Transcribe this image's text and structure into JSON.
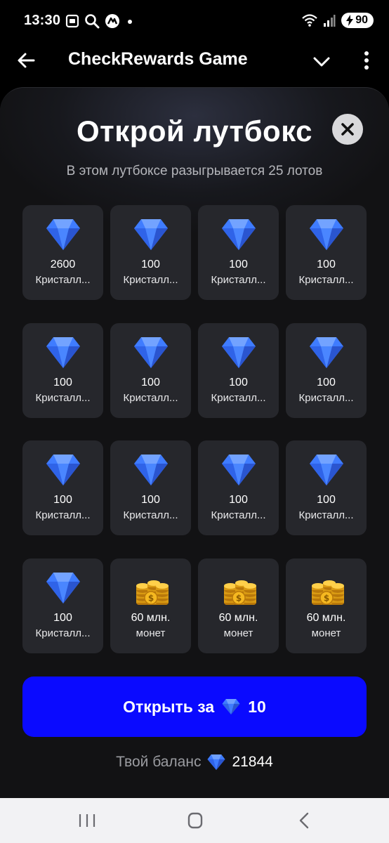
{
  "status": {
    "time": "13:30",
    "battery": "90",
    "left_icons": [
      "screenshot-icon",
      "search-icon",
      "app-badge-icon",
      "dot-icon"
    ],
    "right_icons": [
      "wifi-icon",
      "signal-icon",
      "battery-icon"
    ]
  },
  "appbar": {
    "title": "CheckRewards Game"
  },
  "sheet": {
    "title": "Открой лутбокс",
    "subtitle": "В этом лутбоксе разыгрывается 25 лотов",
    "items": [
      {
        "value": "2600",
        "name": "Кристалл...",
        "icon": "diamond"
      },
      {
        "value": "100",
        "name": "Кристалл...",
        "icon": "diamond"
      },
      {
        "value": "100",
        "name": "Кристалл...",
        "icon": "diamond"
      },
      {
        "value": "100",
        "name": "Кристалл...",
        "icon": "diamond"
      },
      {
        "value": "100",
        "name": "Кристалл...",
        "icon": "diamond"
      },
      {
        "value": "100",
        "name": "Кристалл...",
        "icon": "diamond"
      },
      {
        "value": "100",
        "name": "Кристалл...",
        "icon": "diamond"
      },
      {
        "value": "100",
        "name": "Кристалл...",
        "icon": "diamond"
      },
      {
        "value": "100",
        "name": "Кристалл...",
        "icon": "diamond"
      },
      {
        "value": "100",
        "name": "Кристалл...",
        "icon": "diamond"
      },
      {
        "value": "100",
        "name": "Кристалл...",
        "icon": "diamond"
      },
      {
        "value": "100",
        "name": "Кристалл...",
        "icon": "diamond"
      },
      {
        "value": "100",
        "name": "Кристалл...",
        "icon": "diamond"
      },
      {
        "value": "60 млн.",
        "name": "монет",
        "icon": "coins"
      },
      {
        "value": "60 млн.",
        "name": "монет",
        "icon": "coins"
      },
      {
        "value": "60 млн.",
        "name": "монет",
        "icon": "coins"
      }
    ],
    "open_button": {
      "label": "Открыть за",
      "price": "10"
    },
    "balance": {
      "label": "Твой баланс",
      "value": "21844"
    }
  },
  "colors": {
    "background": "#000000",
    "sheet": "#121214",
    "tile": "#26272c",
    "accent_button": "#0a0aff",
    "diamond": "#3f7cff",
    "coin": "#f2b21c"
  }
}
